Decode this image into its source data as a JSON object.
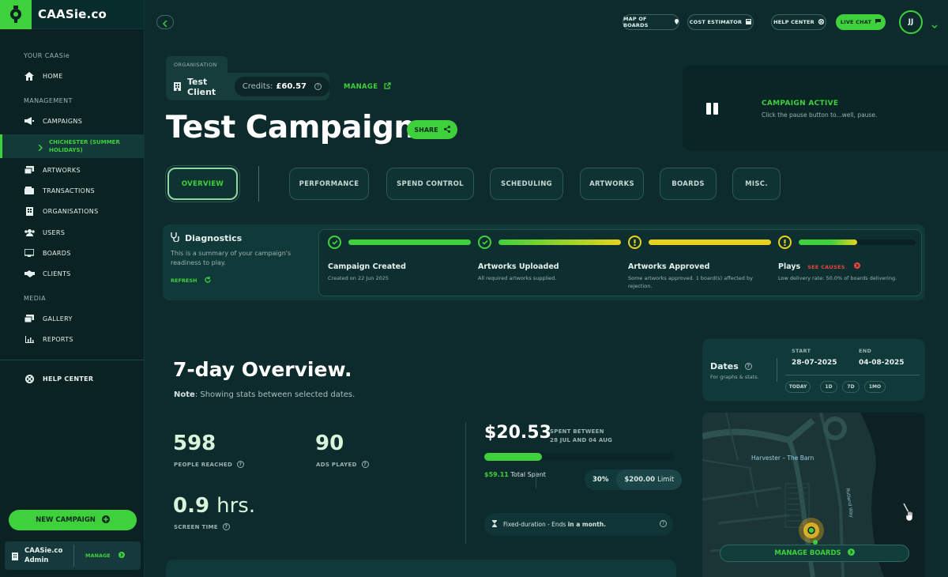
{
  "brand": {
    "name": "CAASie.co"
  },
  "sidebar": {
    "section_your": "YOUR CAASie",
    "home": "HOME",
    "section_management": "MANAGEMENT",
    "campaigns": "CAMPAIGNS",
    "campaign_sub": "CHICHESTER (SUMMER HOLIDAYS)",
    "artworks": "ARTWORKS",
    "transactions": "TRANSACTIONS",
    "organisations": "ORGANISATIONS",
    "users": "USERS",
    "boards": "BOARDS",
    "clients": "CLIENTS",
    "section_media": "MEDIA",
    "gallery": "GALLERY",
    "reports": "REPORTS",
    "help_center": "HELP CENTER",
    "new_campaign": "NEW CAMPAIGN",
    "admin_name": "CAASie.co Admin",
    "admin_manage": "MANAGE"
  },
  "topbar": {
    "map_of_boards": "MAP OF BOARDS",
    "cost_estimator": "COST ESTIMATOR",
    "help_center": "HELP CENTER",
    "live_chat": "LIVE CHAT",
    "avatar": "JJ"
  },
  "header": {
    "org_label": "ORGANISATION",
    "client": "Test Client",
    "credits_label": "Credits:",
    "credits_value": "£60.57",
    "manage": "MANAGE",
    "title": "Test Campaign",
    "share": "SHARE",
    "status_title": "CAMPAIGN ACTIVE",
    "status_desc": "Click the pause button to...well, pause."
  },
  "tabs": [
    "OVERVIEW",
    "PERFORMANCE",
    "SPEND CONTROL",
    "SCHEDULING",
    "ARTWORKS",
    "BOARDS",
    "MISC."
  ],
  "diagnostics": {
    "title": "Diagnostics",
    "desc": "This is a summary of your campaign's readiness to play.",
    "refresh": "REFRESH",
    "steps": [
      {
        "name": "Campaign Created",
        "sub": "Created on 22 Jun 2025",
        "status": "ok",
        "progress": 1.0
      },
      {
        "name": "Artworks Uploaded",
        "sub": "All required artworks supplied.",
        "status": "ok",
        "progress": 1.0
      },
      {
        "name": "Artworks Approved",
        "sub": "Some artworks approved. 1 board(s) affected by rejection.",
        "status": "warn",
        "progress": 1.0
      },
      {
        "name": "Plays",
        "sub": "Low delivery rate: 50.0% of boards delivering.",
        "status": "warn",
        "progress": 0.5,
        "link": "SEE CAUSES"
      }
    ]
  },
  "overview": {
    "title_prefix": "7-day",
    "title_bold": "Overview",
    "note_bold": "Note",
    "note_text": ": Showing stats between selected dates.",
    "people_reached": "598",
    "people_reached_label": "PEOPLE REACHED",
    "ads_played": "90",
    "ads_played_label": "ADS PLAYED",
    "screen_time": "0.9",
    "screen_time_unit": "hrs.",
    "screen_time_label": "SCREEN TIME"
  },
  "spend": {
    "amount": "$20.53",
    "between_line1": "SPENT BETWEEN",
    "between_line2": "28 JUL AND 04 AUG",
    "progress": 0.3,
    "total_value": "$59.11",
    "total_label": "Total Spent",
    "pct": "30%",
    "limit_value": "$200.00",
    "limit_label": "Limit",
    "fixed_text": "Fixed-duration - Ends",
    "fixed_bold": "in a month."
  },
  "dates": {
    "label": "Dates",
    "sub": "For graphs & stats.",
    "start_label": "START",
    "start": "28-07-2025",
    "end_label": "END",
    "end": "04-08-2025",
    "chips": [
      "TODAY",
      "1D",
      "7D",
      "1MO"
    ]
  },
  "map": {
    "place": "Harvester – The Barn",
    "road": "Rutland Way",
    "manage_boards": "MANAGE BOARDS"
  },
  "colors": {
    "accent": "#3fd13b",
    "warning": "#e8d21c",
    "danger": "#e4483f",
    "bg": "#0d2b2c"
  }
}
